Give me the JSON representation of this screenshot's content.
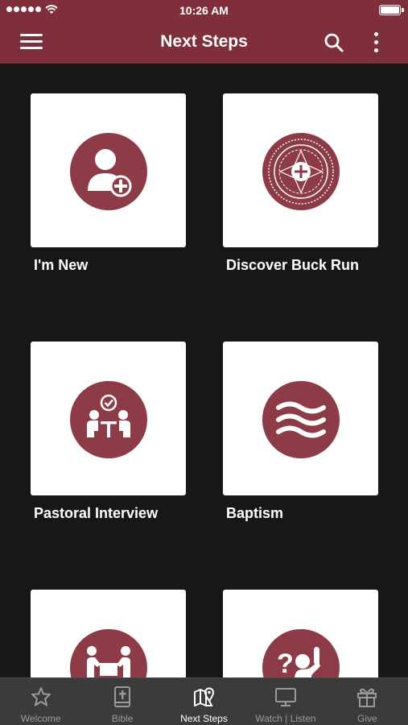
{
  "status_bar": {
    "time": "10:26 AM",
    "signal_icon": "signal-dots-icon",
    "wifi_icon": "wifi-icon",
    "battery_icon": "battery-icon"
  },
  "nav_bar": {
    "title": "Next Steps",
    "menu_icon": "hamburger-menu-icon",
    "search_icon": "search-icon",
    "more_icon": "more-vertical-icon",
    "background": "#7f2f3b"
  },
  "cards": [
    {
      "label": "I'm New",
      "icon": "person-add-icon"
    },
    {
      "label": "Discover Buck Run",
      "icon": "church-seal-icon"
    },
    {
      "label": "Pastoral Interview",
      "icon": "meeting-interview-icon"
    },
    {
      "label": "Baptism",
      "icon": "waves-icon"
    },
    {
      "label": "",
      "icon": "people-carrying-box-icon"
    },
    {
      "label": "",
      "icon": "question-person-icon"
    }
  ],
  "tabs": [
    {
      "label": "Welcome",
      "icon": "star-icon",
      "active": false
    },
    {
      "label": "Bible",
      "icon": "bible-icon",
      "active": false
    },
    {
      "label": "Next Steps",
      "icon": "map-pin-icon",
      "active": true
    },
    {
      "label": "Watch | Listen",
      "icon": "monitor-icon",
      "active": false
    },
    {
      "label": "Give",
      "icon": "gift-icon",
      "active": false
    }
  ],
  "colors": {
    "accent": "#8c3b47",
    "background": "#171717",
    "tab_bar": "#3b3b3b",
    "tile": "#ffffff"
  }
}
